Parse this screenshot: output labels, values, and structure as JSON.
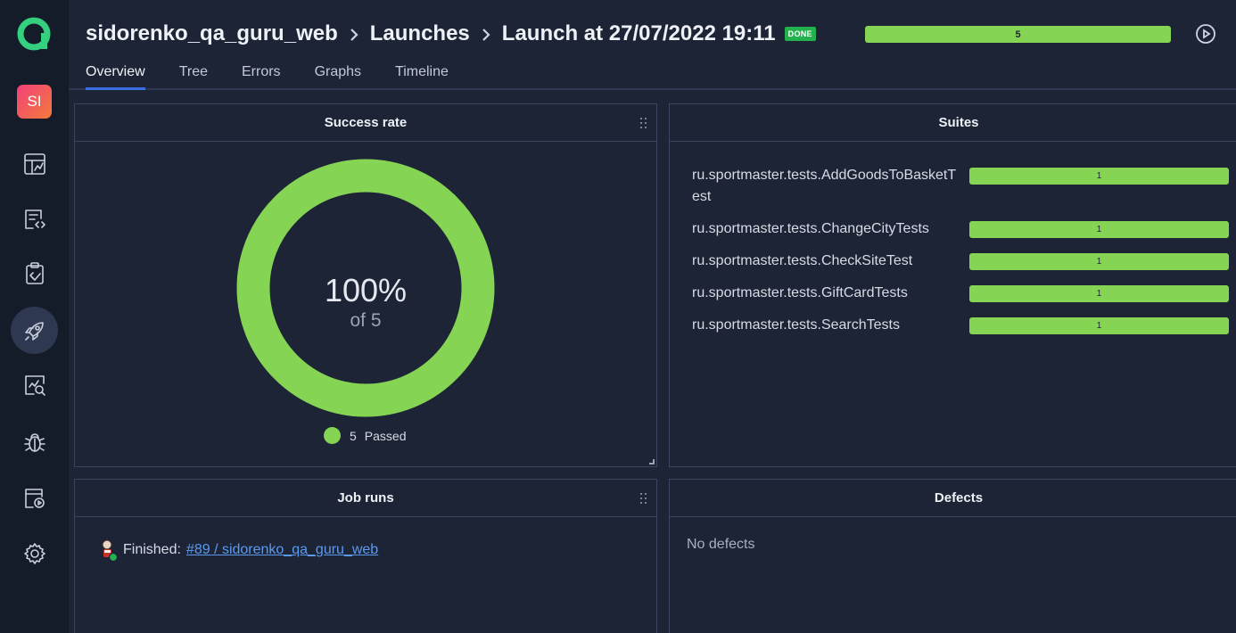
{
  "sidebar": {
    "avatar_initials": "SI",
    "items": [
      {
        "name": "dashboards",
        "icon": "dashboard-icon"
      },
      {
        "name": "test-cases",
        "icon": "test-cases-icon"
      },
      {
        "name": "test-plans",
        "icon": "test-plans-icon"
      },
      {
        "name": "launches",
        "icon": "rocket-icon",
        "active": true
      },
      {
        "name": "analytics",
        "icon": "analytics-icon"
      },
      {
        "name": "defects",
        "icon": "bug-icon"
      },
      {
        "name": "jobs",
        "icon": "jobs-icon"
      },
      {
        "name": "settings",
        "icon": "gear-icon"
      }
    ]
  },
  "header": {
    "breadcrumb": [
      "sidorenko_qa_guru_web",
      "Launches",
      "Launch at 27/07/2022 19:11"
    ],
    "status_badge": "DONE",
    "progress_label": "5",
    "progress_fraction": 1.0,
    "tabs": [
      "Overview",
      "Tree",
      "Errors",
      "Graphs",
      "Timeline"
    ],
    "active_tab": "Overview"
  },
  "success_rate": {
    "title": "Success rate",
    "percent_label": "100%",
    "of_label": "of 5",
    "legend_count": "5",
    "legend_label": "Passed",
    "passed_color": "#86d454"
  },
  "suites": {
    "title": "Suites",
    "rows": [
      {
        "name": "ru.sportmaster.tests.AddGoodsToBasketTest",
        "count": "1"
      },
      {
        "name": "ru.sportmaster.tests.ChangeCityTests",
        "count": "1"
      },
      {
        "name": "ru.sportmaster.tests.CheckSiteTest",
        "count": "1"
      },
      {
        "name": "ru.sportmaster.tests.GiftCardTests",
        "count": "1"
      },
      {
        "name": "ru.sportmaster.tests.SearchTests",
        "count": "1"
      }
    ]
  },
  "job_runs": {
    "title": "Job runs",
    "status_label": "Finished:",
    "link_text": "#89 / sidorenko_qa_guru_web"
  },
  "defects": {
    "title": "Defects",
    "empty_text": "No defects"
  }
}
